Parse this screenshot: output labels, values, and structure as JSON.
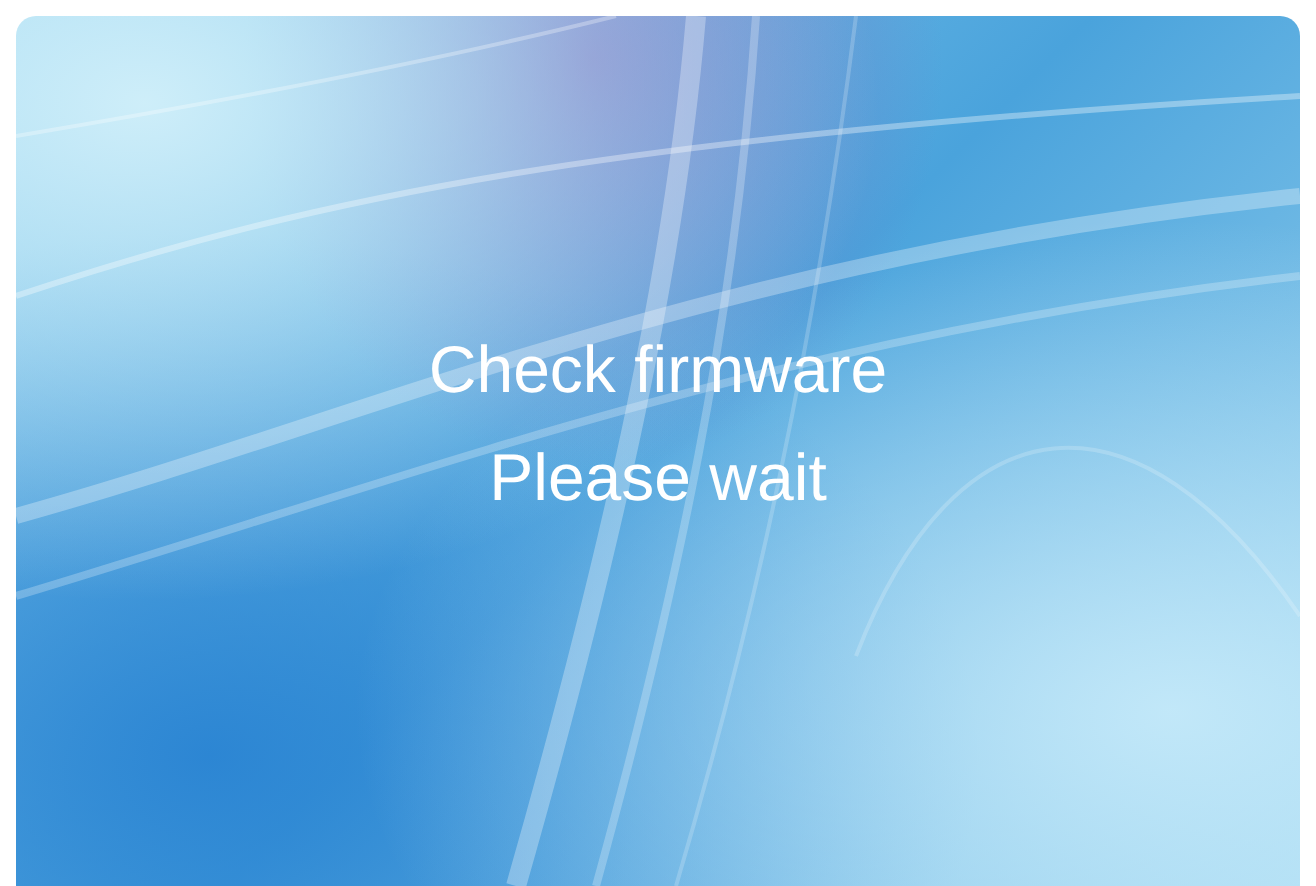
{
  "screen": {
    "messages": [
      "Check firmware",
      "Please wait"
    ]
  }
}
